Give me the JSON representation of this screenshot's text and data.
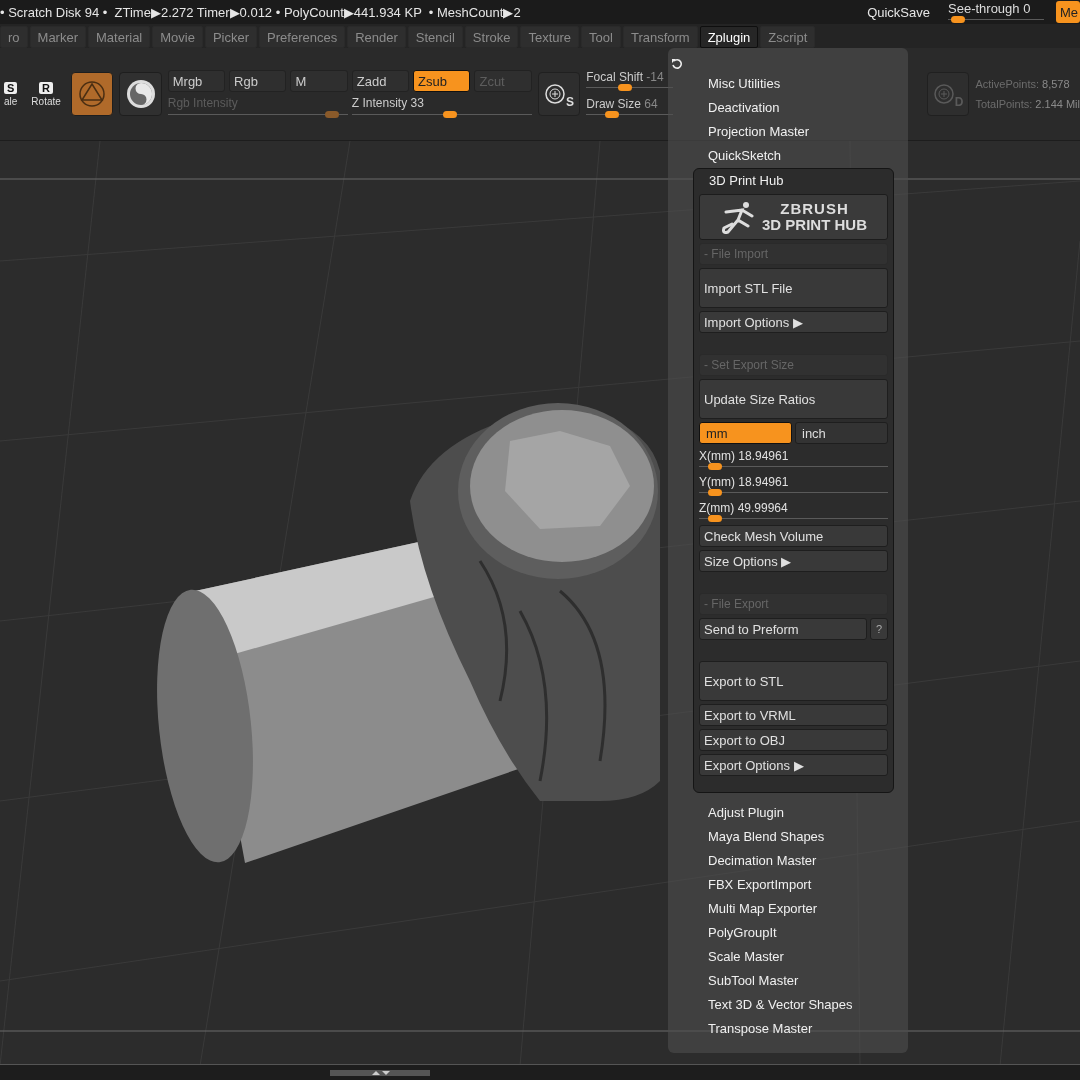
{
  "status_bar": {
    "text": "• Scratch Disk 94 •  ZTime▶2.272 Timer▶0.012 • PolyCount▶441.934 KP  • MeshCount▶2",
    "quicksave": "QuickSave",
    "see_through": {
      "label": "See-through",
      "value": "0",
      "level": 0.04
    },
    "corner_button": "Me"
  },
  "menu_tabs": [
    {
      "label": "ro",
      "selected": false
    },
    {
      "label": "Marker",
      "selected": false
    },
    {
      "label": "Material",
      "selected": false
    },
    {
      "label": "Movie",
      "selected": false
    },
    {
      "label": "Picker",
      "selected": false
    },
    {
      "label": "Preferences",
      "selected": false
    },
    {
      "label": "Render",
      "selected": false
    },
    {
      "label": "Stencil",
      "selected": false
    },
    {
      "label": "Stroke",
      "selected": false
    },
    {
      "label": "Texture",
      "selected": false
    },
    {
      "label": "Tool",
      "selected": false
    },
    {
      "label": "Transform",
      "selected": false
    },
    {
      "label": "Zplugin",
      "selected": true
    },
    {
      "label": "Zscript",
      "selected": false
    }
  ],
  "toolbar": {
    "transform_buttons": [
      {
        "key": "S",
        "label": "ale"
      },
      {
        "key": "R",
        "label": "Rotate"
      }
    ],
    "mode_buttons": [
      {
        "kind": "draw",
        "selected": true
      },
      {
        "kind": "material",
        "selected": false
      }
    ],
    "channel_buttons": [
      {
        "label": "Mrgb",
        "selected": false,
        "disabled": false
      },
      {
        "label": "Rgb",
        "selected": false,
        "disabled": false
      },
      {
        "label": "M",
        "selected": false,
        "disabled": false
      },
      {
        "label": "Zadd",
        "selected": false,
        "disabled": false
      },
      {
        "label": "Zsub",
        "selected": true,
        "disabled": false
      },
      {
        "label": "Zcut",
        "selected": false,
        "disabled": true
      }
    ],
    "intensity_sliders": [
      {
        "label": "Rgb Intensity",
        "disabled": true,
        "level": 0.95
      },
      {
        "label": "Z Intensity 33",
        "disabled": false,
        "level": 0.55
      }
    ],
    "brush_button": {
      "badge": "S",
      "disabled": false
    },
    "brush_sliders": [
      {
        "label": "Focal Shift",
        "value": "-14",
        "level": 0.43
      },
      {
        "label": "Draw Size",
        "value": "64",
        "level": 0.26
      }
    ],
    "dynamic_button": {
      "badge": "D",
      "disabled": true
    },
    "stats": [
      {
        "label": "ActivePoints:",
        "value": "8,578"
      },
      {
        "label": "TotalPoints:",
        "value": "2.144 Mil"
      }
    ]
  },
  "zplugin_menu": {
    "items": [
      {
        "label": "Misc Utilities",
        "expanded": false
      },
      {
        "label": "Deactivation",
        "expanded": false
      },
      {
        "label": "Projection Master",
        "expanded": false
      },
      {
        "label": "QuickSketch",
        "expanded": false
      },
      {
        "label": "3D Print Hub",
        "expanded": true,
        "sections": [
          [
            {
              "kind": "logo",
              "title": "ZBRUSH",
              "subtitle": "3D PRINT HUB"
            },
            {
              "kind": "header",
              "label": "- File Import"
            },
            {
              "kind": "button",
              "label": "Import STL File",
              "tall": true
            },
            {
              "kind": "button",
              "label": "Import Options ▶",
              "tall": false
            }
          ],
          [
            {
              "kind": "header",
              "label": "- Set Export Size"
            },
            {
              "kind": "button",
              "label": "Update Size Ratios",
              "tall": true
            },
            {
              "kind": "toggle",
              "options": [
                {
                  "label": "mm",
                  "selected": true
                },
                {
                  "label": "inch",
                  "selected": false
                }
              ]
            },
            {
              "kind": "slider",
              "label": "X(mm)",
              "value": "18.94961",
              "level": 0.05
            },
            {
              "kind": "slider",
              "label": "Y(mm)",
              "value": "18.94961",
              "level": 0.05
            },
            {
              "kind": "slider",
              "label": "Z(mm)",
              "value": "49.99964",
              "level": 0.05
            },
            {
              "kind": "button",
              "label": "Check Mesh Volume",
              "tall": false
            },
            {
              "kind": "button",
              "label": "Size Options ▶",
              "tall": false
            }
          ],
          [
            {
              "kind": "header",
              "label": "- File Export"
            },
            {
              "kind": "help-button",
              "label": "Send to Preform",
              "help": "?"
            }
          ],
          [
            {
              "kind": "button",
              "label": "Export to STL",
              "tall": true
            },
            {
              "kind": "button",
              "label": "Export to VRML",
              "tall": false
            },
            {
              "kind": "button",
              "label": "Export to OBJ",
              "tall": false
            },
            {
              "kind": "button",
              "label": "Export Options ▶",
              "tall": false
            }
          ]
        ]
      },
      {
        "label": "Adjust Plugin",
        "expanded": false
      },
      {
        "label": "Maya Blend Shapes",
        "expanded": false
      },
      {
        "label": "Decimation Master",
        "expanded": false
      },
      {
        "label": "FBX ExportImport",
        "expanded": false
      },
      {
        "label": "Multi Map Exporter",
        "expanded": false
      },
      {
        "label": "PolyGroupIt",
        "expanded": false
      },
      {
        "label": "Scale Master",
        "expanded": false
      },
      {
        "label": "SubTool Master",
        "expanded": false
      },
      {
        "label": "Text 3D & Vector Shapes",
        "expanded": false
      },
      {
        "label": "Transpose Master",
        "expanded": false
      }
    ]
  }
}
